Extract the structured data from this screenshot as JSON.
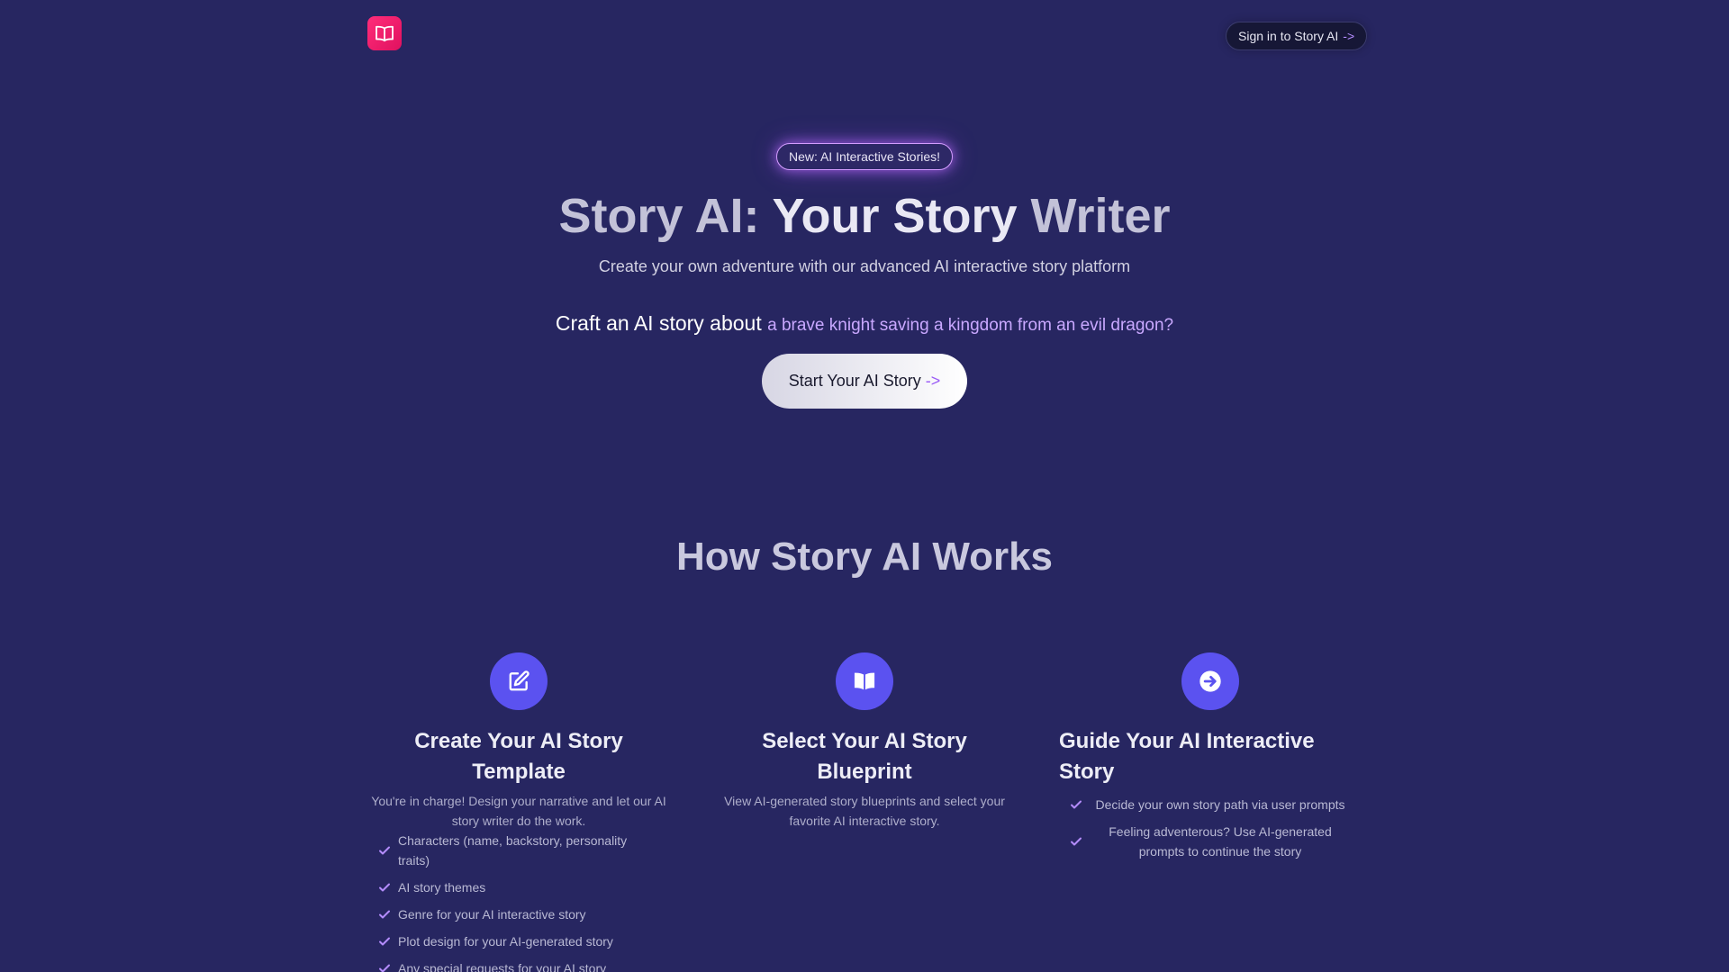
{
  "header": {
    "logo_icon": "open-book-icon",
    "signin_label": "Sign in to Story AI",
    "signin_arrow": "->"
  },
  "hero": {
    "badge": "New: AI Interactive Stories!",
    "title_part1": "Story AI: ",
    "title_part2": "Your Story",
    "title_part3": " Writer",
    "subtitle": "Create your own adventure with our advanced AI interactive story platform",
    "craft_prefix": "Craft an AI story about",
    "craft_topic": "a brave knight saving a kingdom from an evil dragon?",
    "cta_label": "Start Your AI Story",
    "cta_arrow": "->"
  },
  "how": {
    "title": "How Story AI Works",
    "steps": [
      {
        "icon": "edit-square-icon",
        "title": "Create Your AI Story Template",
        "description": "You're in charge! Design your narrative and let our AI story writer do the work.",
        "checks": [
          "Characters (name, backstory, personality traits)",
          "AI story themes",
          "Genre for your AI interactive story",
          "Plot design for your AI-generated story",
          "Any special requests for your AI story"
        ]
      },
      {
        "icon": "open-book-icon",
        "title": "Select Your AI Story Blueprint",
        "description": "View AI-generated story blueprints and select your favorite AI interactive story.",
        "checks": []
      },
      {
        "icon": "arrow-right-circle-icon",
        "title": "Guide Your AI Interactive Story",
        "description": "",
        "checks": [
          "Decide your own story path via user prompts",
          "Feeling adventerous? Use AI-generated prompts to continue the story"
        ]
      }
    ]
  },
  "colors": {
    "background": "#272661",
    "accent_purple": "#b48cff",
    "icon_circle": "#5b52f0",
    "logo_pink": "#ff2d7a"
  }
}
